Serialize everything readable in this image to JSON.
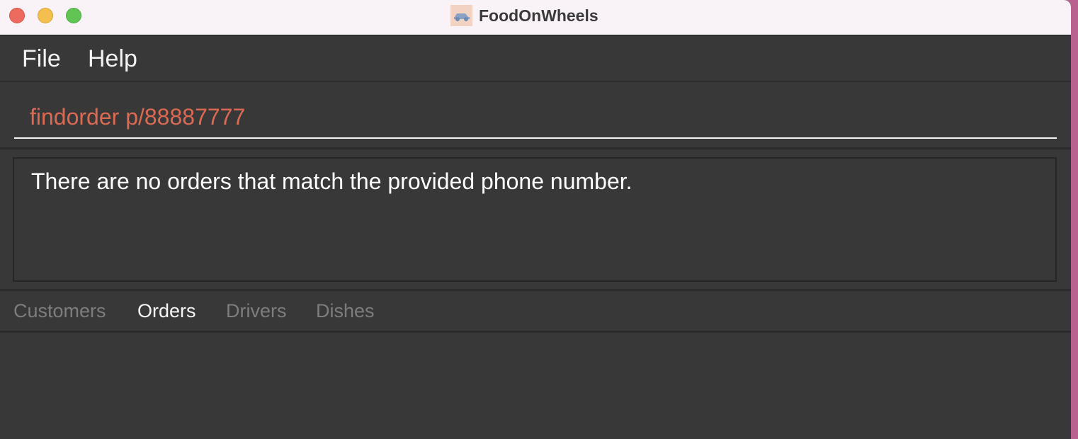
{
  "window": {
    "title": "FoodOnWheels",
    "icon": "delivery-car-icon"
  },
  "menu": {
    "file": "File",
    "help": "Help"
  },
  "command": {
    "value": "findorder p/88887777"
  },
  "result": {
    "message": "There are no orders that match the provided phone number."
  },
  "tabs": [
    {
      "label": "Customers",
      "active": false
    },
    {
      "label": "Orders",
      "active": true
    },
    {
      "label": "Drivers",
      "active": false
    },
    {
      "label": "Dishes",
      "active": false
    }
  ],
  "colors": {
    "background": "#383838",
    "command_text": "#dc6a53",
    "active_tab": "#f5f5f5",
    "inactive_tab": "#7d7d7d"
  }
}
